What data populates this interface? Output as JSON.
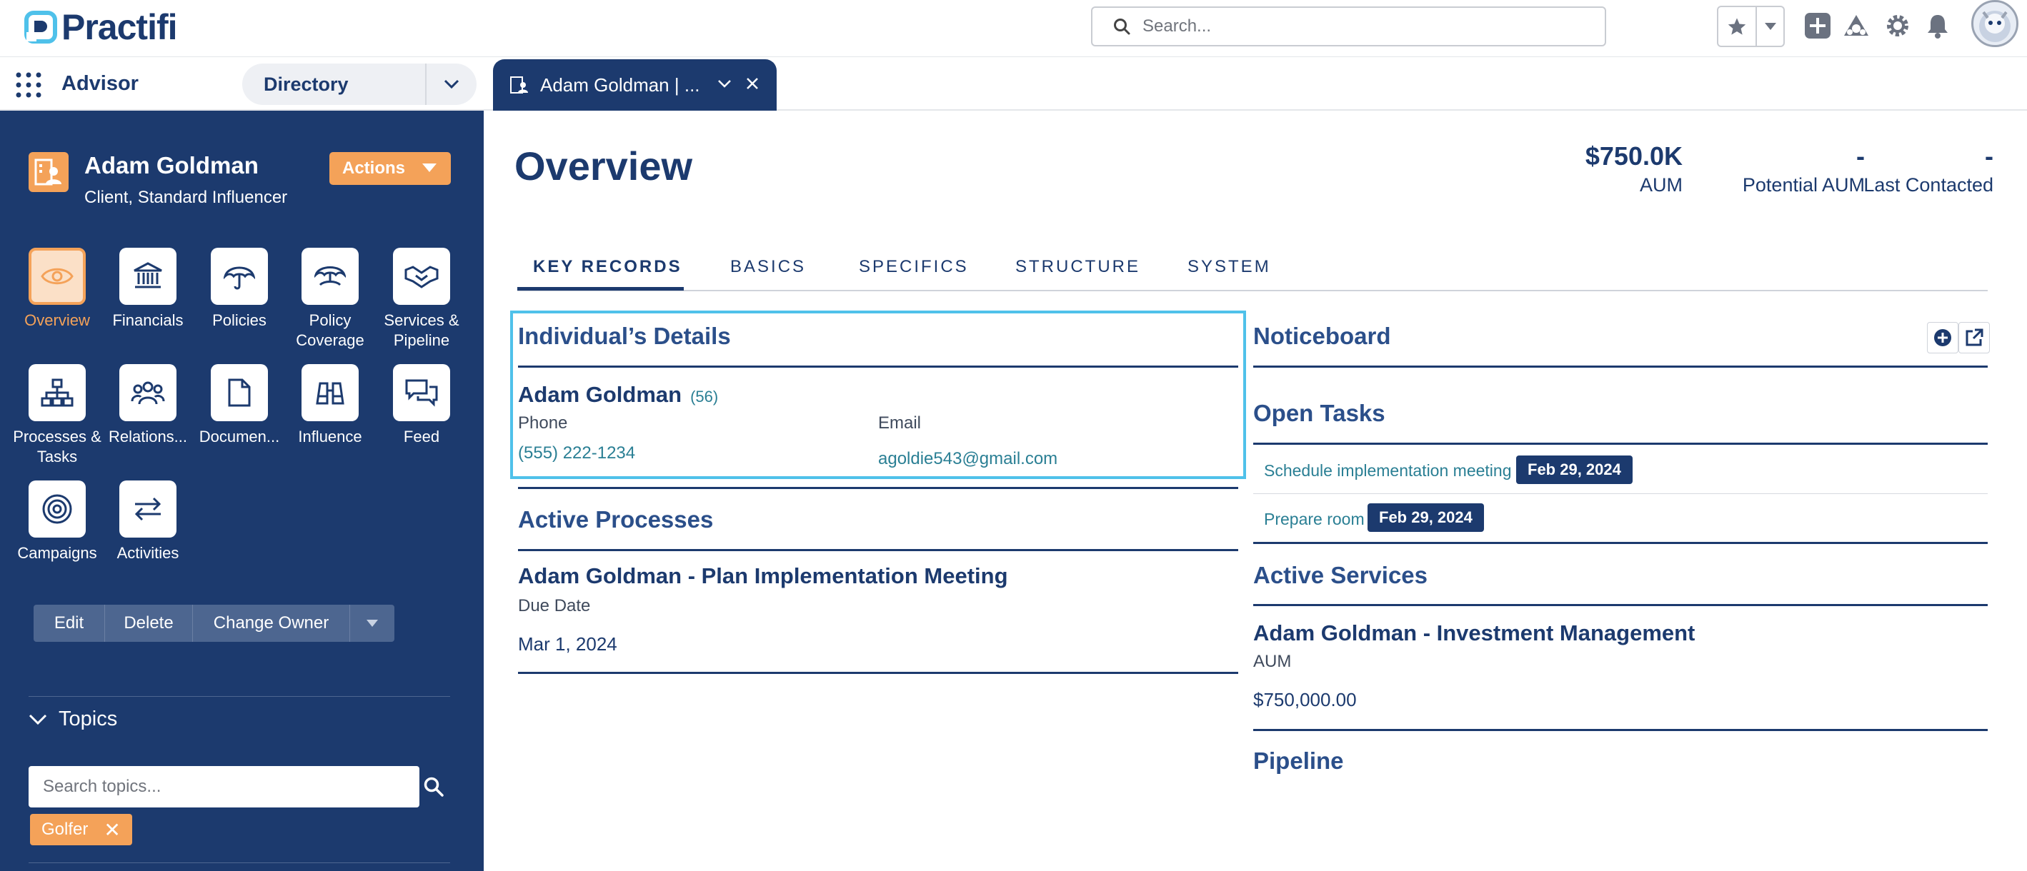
{
  "brand": {
    "name": "Practifi",
    "accent": "#4fc1ea",
    "navy": "#1c3a6e",
    "orange": "#f4a259"
  },
  "topbar": {
    "search_placeholder": "Search..."
  },
  "appbar": {
    "app_name": "Advisor",
    "directory": "Directory",
    "record_tab": "Adam Goldman | ..."
  },
  "client": {
    "name": "Adam Goldman",
    "type": "Client, Standard Influencer",
    "actions_label": "Actions"
  },
  "nav": [
    {
      "label": "Overview",
      "icon": "eye-icon",
      "active": true
    },
    {
      "label": "Financials",
      "icon": "bank-icon"
    },
    {
      "label": "Policies",
      "icon": "umbrella-icon"
    },
    {
      "label": "Policy Coverage",
      "icon": "umbrella-hand-icon"
    },
    {
      "label": "Services & Pipeline",
      "icon": "handshake-icon"
    },
    {
      "label": "Processes & Tasks",
      "icon": "hierarchy-icon"
    },
    {
      "label": "Relations...",
      "icon": "people-icon"
    },
    {
      "label": "Documen...",
      "icon": "document-icon"
    },
    {
      "label": "Influence",
      "icon": "binoculars-icon"
    },
    {
      "label": "Feed",
      "icon": "chat-icon"
    },
    {
      "label": "Campaigns",
      "icon": "target-icon"
    },
    {
      "label": "Activities",
      "icon": "arrows-icon"
    }
  ],
  "record_actions": {
    "edit": "Edit",
    "delete": "Delete",
    "change_owner": "Change Owner"
  },
  "topics": {
    "title": "Topics",
    "search_placeholder": "Search topics...",
    "chips": [
      "Golfer"
    ]
  },
  "overview": {
    "title": "Overview",
    "metrics": [
      {
        "value": "$750.0K",
        "label": "AUM"
      },
      {
        "value": "-",
        "label": "Potential AUM"
      },
      {
        "value": "-",
        "label": "Last Contacted"
      }
    ],
    "tabs": [
      "KEY RECORDS",
      "BASICS",
      "SPECIFICS",
      "STRUCTURE",
      "SYSTEM"
    ],
    "active_tab": "KEY RECORDS"
  },
  "individual": {
    "title": "Individual’s Details",
    "name": "Adam Goldman",
    "age": "(56)",
    "phone_label": "Phone",
    "phone": "(555) 222-1234",
    "email_label": "Email",
    "email": "agoldie543@gmail.com"
  },
  "active_processes": {
    "title": "Active Processes",
    "item_name": "Adam Goldman - Plan Implementation Meeting",
    "due_label": "Due Date",
    "due_value": "Mar 1, 2024"
  },
  "noticeboard": {
    "title": "Noticeboard"
  },
  "open_tasks": {
    "title": "Open Tasks",
    "items": [
      {
        "text": "Schedule implementation meeting",
        "date": "Feb 29, 2024"
      },
      {
        "text": "Prepare room",
        "date": "Feb 29, 2024"
      }
    ]
  },
  "active_services": {
    "title": "Active Services",
    "item_name": "Adam Goldman - Investment Management",
    "aum_label": "AUM",
    "aum_value": "$750,000.00"
  },
  "pipeline": {
    "title": "Pipeline"
  }
}
